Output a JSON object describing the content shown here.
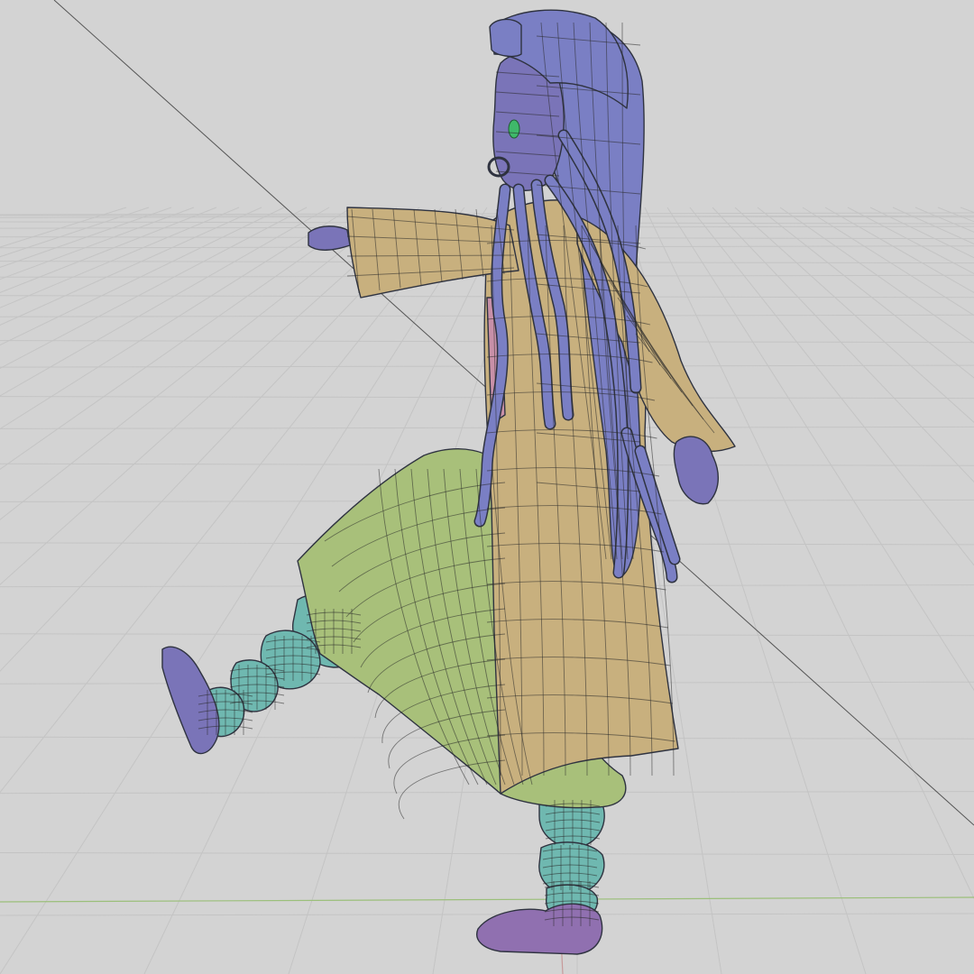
{
  "viewport": {
    "background": "#d3d3d3",
    "grid_color": "#c4c4c4",
    "ground_axis_color": "#9bbf7a",
    "vertical_axis_color": "#c79a9a"
  },
  "model": {
    "materials": {
      "hair": "#7a7fc4",
      "skin": "#7a74b8",
      "coat": "#c8b07e",
      "coat_shadow": "#a89060",
      "pants": "#a8c07a",
      "pants_shadow": "#8fa864",
      "legs": "#6fb8b0",
      "knee": "#8a6fb0",
      "sandal": "#7a74b8",
      "sandal_strap": "#9070b0",
      "undershirt": "#c890a8",
      "eye": "#3fb86a",
      "wire": "#2f3340"
    }
  }
}
